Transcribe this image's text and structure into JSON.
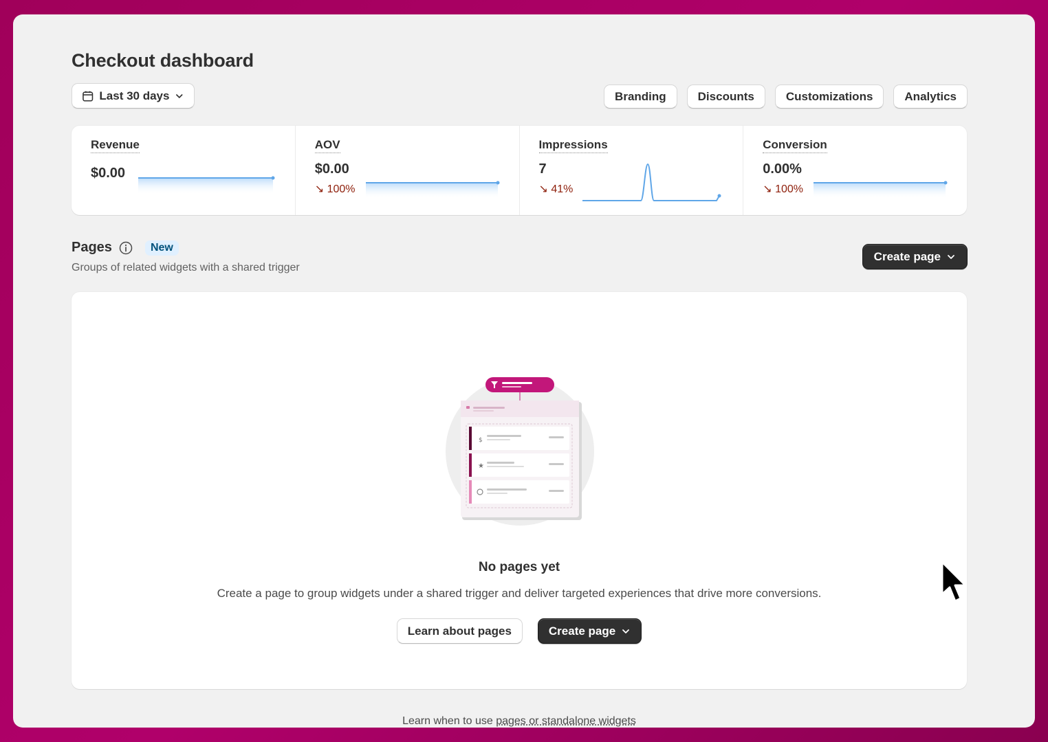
{
  "page": {
    "title": "Checkout dashboard"
  },
  "date_filter": {
    "label": "Last 30 days",
    "icon": "calendar-icon"
  },
  "nav": {
    "branding": "Branding",
    "discounts": "Discounts",
    "customizations": "Customizations",
    "analytics": "Analytics"
  },
  "metrics": [
    {
      "label": "Revenue",
      "value": "$0.00",
      "delta": ""
    },
    {
      "label": "AOV",
      "value": "$0.00",
      "delta": "↘ 100%"
    },
    {
      "label": "Impressions",
      "value": "7",
      "delta": "↘ 41%"
    },
    {
      "label": "Conversion",
      "value": "0.00%",
      "delta": "↘ 100%"
    }
  ],
  "pages_section": {
    "title": "Pages",
    "badge": "New",
    "subtitle": "Groups of related widgets with a shared trigger",
    "create_label": "Create page"
  },
  "empty_state": {
    "title": "No pages yet",
    "description": "Create a page to group widgets under a shared trigger and deliver targeted experiences that drive more conversions.",
    "learn_label": "Learn about pages",
    "create_label": "Create page"
  },
  "footer": {
    "prefix": "Learn when to use ",
    "link": "pages or standalone widgets"
  },
  "colors": {
    "background": "#a0005a",
    "accent": "#c2177a",
    "sparkline": "#5fa6e8",
    "negative": "#8e1f0b",
    "badge_bg": "#e0f0ff"
  }
}
